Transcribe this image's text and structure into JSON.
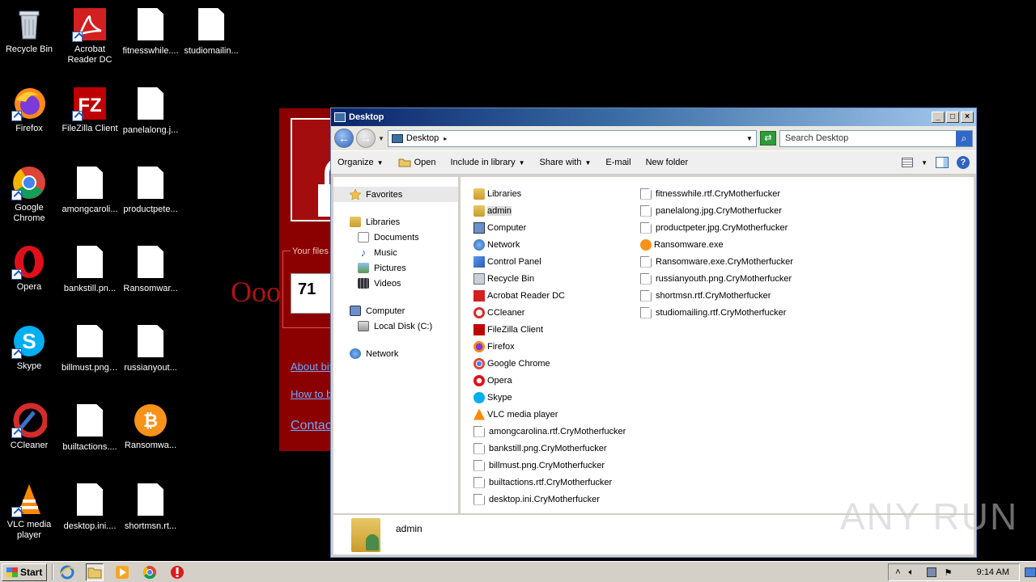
{
  "desktop": {
    "icons": [
      {
        "label": "Recycle Bin",
        "icon": "recycle-bin-icon"
      },
      {
        "label": "Acrobat Reader DC",
        "icon": "acrobat-reader-icon"
      },
      {
        "label": "fitnesswhile....",
        "icon": "document-icon"
      },
      {
        "label": "studiomailin...",
        "icon": "document-icon"
      },
      {
        "label": "Firefox",
        "icon": "firefox-icon"
      },
      {
        "label": "FileZilla Client",
        "icon": "filezilla-icon"
      },
      {
        "label": "panelalong.j...",
        "icon": "document-icon"
      },
      {
        "label": "Google Chrome",
        "icon": "chrome-icon"
      },
      {
        "label": "amongcaroli...",
        "icon": "document-icon"
      },
      {
        "label": "productpete...",
        "icon": "document-icon"
      },
      {
        "label": "Opera",
        "icon": "opera-icon"
      },
      {
        "label": "bankstill.pn...",
        "icon": "document-icon"
      },
      {
        "label": "Ransomwar...",
        "icon": "document-icon"
      },
      {
        "label": "Skype",
        "icon": "skype-icon"
      },
      {
        "label": "billmust.png....",
        "icon": "document-icon"
      },
      {
        "label": "russianyout...",
        "icon": "document-icon"
      },
      {
        "label": "CCleaner",
        "icon": "ccleaner-icon"
      },
      {
        "label": "builtactions....",
        "icon": "document-icon"
      },
      {
        "label": "Ransomwa...",
        "icon": "bitcoin-icon"
      },
      {
        "label": "VLC media player",
        "icon": "vlc-icon"
      },
      {
        "label": "desktop.ini....",
        "icon": "document-icon"
      },
      {
        "label": "shortmsn.rt...",
        "icon": "document-icon"
      }
    ]
  },
  "ransom": {
    "files_label": "Your files w",
    "timer": "71",
    "big_text": "Ooo",
    "link_about": "About bit",
    "link_how": "How to b",
    "link_contact": "Contac"
  },
  "explorer": {
    "title": "Desktop",
    "address": "Desktop",
    "search_placeholder": "Search Desktop",
    "toolbar": {
      "organize": "Organize",
      "open": "Open",
      "include": "Include in library",
      "share": "Share with",
      "email": "E-mail",
      "new_folder": "New folder"
    },
    "nav": {
      "favorites": "Favorites",
      "libraries": "Libraries",
      "documents": "Documents",
      "music": "Music",
      "pictures": "Pictures",
      "videos": "Videos",
      "computer": "Computer",
      "local_disk": "Local Disk (C:)",
      "network": "Network"
    },
    "files_col1": [
      {
        "name": "Libraries",
        "icon": "libraries-icon"
      },
      {
        "name": "admin",
        "icon": "user-folder-icon"
      },
      {
        "name": "Computer",
        "icon": "computer-icon"
      },
      {
        "name": "Network",
        "icon": "network-icon"
      },
      {
        "name": "Control Panel",
        "icon": "control-panel-icon"
      },
      {
        "name": "Recycle Bin",
        "icon": "recycle-bin-icon"
      },
      {
        "name": "Acrobat Reader DC",
        "icon": "acrobat-reader-icon"
      },
      {
        "name": "CCleaner",
        "icon": "ccleaner-icon"
      },
      {
        "name": "FileZilla Client",
        "icon": "filezilla-icon"
      },
      {
        "name": "Firefox",
        "icon": "firefox-icon"
      },
      {
        "name": "Google Chrome",
        "icon": "chrome-icon"
      },
      {
        "name": "Opera",
        "icon": "opera-icon"
      },
      {
        "name": "Skype",
        "icon": "skype-icon"
      },
      {
        "name": "VLC media player",
        "icon": "vlc-icon"
      },
      {
        "name": "amongcarolina.rtf.CryMotherfucker",
        "icon": "document-icon"
      },
      {
        "name": "bankstill.png.CryMotherfucker",
        "icon": "document-icon"
      },
      {
        "name": "billmust.png.CryMotherfucker",
        "icon": "document-icon"
      },
      {
        "name": "builtactions.rtf.CryMotherfucker",
        "icon": "document-icon"
      },
      {
        "name": "desktop.ini.CryMotherfucker",
        "icon": "document-icon"
      }
    ],
    "files_col2": [
      {
        "name": "fitnesswhile.rtf.CryMotherfucker",
        "icon": "document-icon"
      },
      {
        "name": "panelalong.jpg.CryMotherfucker",
        "icon": "document-icon"
      },
      {
        "name": "productpeter.jpg.CryMotherfucker",
        "icon": "document-icon"
      },
      {
        "name": "Ransomware.exe",
        "icon": "bitcoin-icon"
      },
      {
        "name": "Ransomware.exe.CryMotherfucker",
        "icon": "document-icon"
      },
      {
        "name": "russianyouth.png.CryMotherfucker",
        "icon": "document-icon"
      },
      {
        "name": "shortmsn.rtf.CryMotherfucker",
        "icon": "document-icon"
      },
      {
        "name": "studiomailing.rtf.CryMotherfucker",
        "icon": "document-icon"
      }
    ],
    "details_name": "admin"
  },
  "watermark": "ANY RUN",
  "taskbar": {
    "start": "Start",
    "clock": "9:14 AM"
  }
}
